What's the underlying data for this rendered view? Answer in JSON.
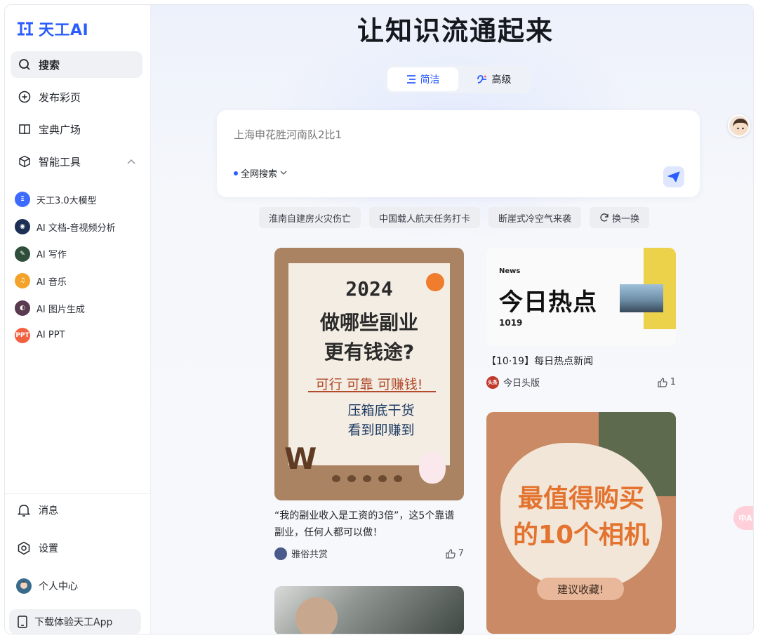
{
  "app": {
    "logo_text": "天工AI",
    "brand_color": "#2b5cff"
  },
  "sidebar": {
    "nav": [
      {
        "label": "搜索",
        "icon": "search-icon",
        "active": true
      },
      {
        "label": "发布彩页",
        "icon": "plus-circle-icon",
        "active": false
      },
      {
        "label": "宝典广场",
        "icon": "book-icon",
        "active": false
      },
      {
        "label": "智能工具",
        "icon": "cube-icon",
        "active": false,
        "expanded": true
      }
    ],
    "tools": [
      {
        "label": "天工3.0大模型",
        "icon": "tiangong-model-icon",
        "color": "#3e6bff"
      },
      {
        "label": "AI 文档-音视频分析",
        "icon": "doc-analysis-icon",
        "color": "#1c2f55"
      },
      {
        "label": "AI 写作",
        "icon": "writing-icon",
        "color": "#2f4f3a"
      },
      {
        "label": "AI 音乐",
        "icon": "music-icon",
        "color": "#f4a32a"
      },
      {
        "label": "AI 图片生成",
        "icon": "image-gen-icon",
        "color": "#5a3a4e"
      },
      {
        "label": "AI PPT",
        "icon": "ppt-icon",
        "color": "#f2613f",
        "badge": "PPT"
      }
    ],
    "bottom": {
      "messages": "消息",
      "settings": "设置",
      "profile": "个人中心",
      "download": "下载体验天工App"
    }
  },
  "main": {
    "headline": "让知识流通起来",
    "modes": [
      {
        "label": "简洁",
        "icon": "list-icon",
        "active": true
      },
      {
        "label": "高级",
        "icon": "advanced-icon",
        "active": false
      }
    ],
    "search": {
      "placeholder": "上海申花胜河南队2比1",
      "scope": "全网搜索"
    },
    "hot_chips": [
      "淮南自建房火灾伤亡",
      "中国载人航天任务打卡",
      "断崖式冷空气来袭"
    ],
    "refresh_label": "换一换",
    "float_translate": "中A"
  },
  "cards": [
    {
      "title": "“我的副业收入是工资的3倍”，这5个靠谱副业，任何人都可以做！",
      "source": "雅俗共赏",
      "likes": "7",
      "image_text": {
        "year": "2024",
        "line1": "做哪些副业",
        "line2": "更有钱途?",
        "slogan": "可行 可靠 可赚钱!",
        "sub1": "压箱底干货",
        "sub2": "看到即赚到",
        "w": "W"
      }
    },
    {
      "title": "【10·19】每日热点新闻",
      "source": "今日头版",
      "source_badge": "头条",
      "likes": "1",
      "image_text": {
        "news": "News",
        "big": "今日热点",
        "num": "1019"
      }
    },
    {
      "title": "",
      "image_text": {
        "line1": "最值得购买",
        "line2": "的10个相机",
        "pill": "建议收藏!"
      }
    }
  ]
}
